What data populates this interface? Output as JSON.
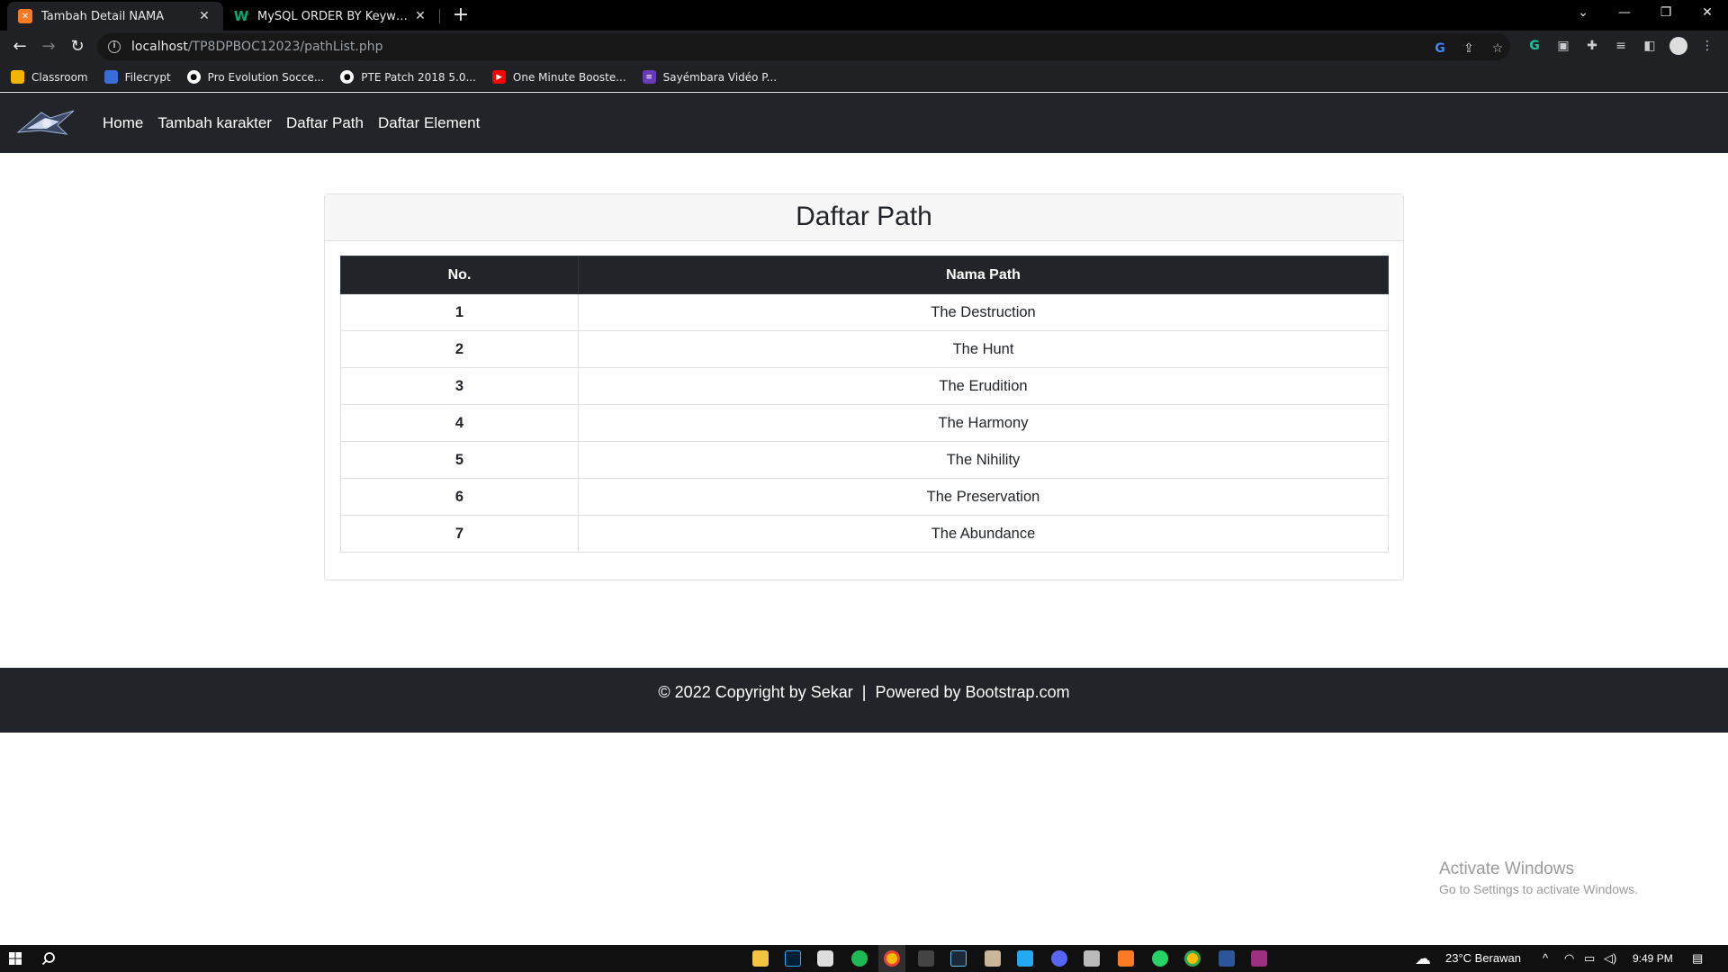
{
  "browser": {
    "tabs": [
      {
        "title": "Tambah Detail NAMA",
        "icon": "xampp-icon",
        "active": true
      },
      {
        "title": "MySQL ORDER BY Keyword",
        "icon": "w3schools-icon",
        "active": false
      }
    ],
    "url_host": "localhost",
    "url_path": "/TP8DPBOC12023/pathList.php",
    "bookmarks": [
      {
        "label": "Classroom",
        "icon": "classroom-icon",
        "color": "#f4b400"
      },
      {
        "label": "Filecrypt",
        "icon": "shield-icon",
        "color": "#3b6dd8"
      },
      {
        "label": "Pro Evolution Socce...",
        "icon": "soccer-ball-icon",
        "color": "#555555"
      },
      {
        "label": "PTE Patch 2018 5.0...",
        "icon": "soccer-ball-icon",
        "color": "#555555"
      },
      {
        "label": "One Minute Booste...",
        "icon": "youtube-icon",
        "color": "#ff0000"
      },
      {
        "label": "Sayémbara Vidéo P...",
        "icon": "form-icon",
        "color": "#673ab7"
      }
    ]
  },
  "site": {
    "nav": [
      "Home",
      "Tambah karakter",
      "Daftar Path",
      "Daftar Element"
    ],
    "card_title": "Daftar Path",
    "table": {
      "headers": [
        "No.",
        "Nama Path"
      ],
      "rows": [
        [
          "1",
          "The Destruction"
        ],
        [
          "2",
          "The Hunt"
        ],
        [
          "3",
          "The Erudition"
        ],
        [
          "4",
          "The Harmony"
        ],
        [
          "5",
          "The Nihility"
        ],
        [
          "6",
          "The Preservation"
        ],
        [
          "7",
          "The Abundance"
        ]
      ]
    },
    "footer": "© 2022 Copyright by Sekar  |  Powered by Bootstrap.com"
  },
  "watermark": {
    "line1": "Activate Windows",
    "line2": "Go to Settings to activate Windows."
  },
  "taskbar": {
    "weather": "23°C  Berawan",
    "time": "9:49 PM"
  }
}
